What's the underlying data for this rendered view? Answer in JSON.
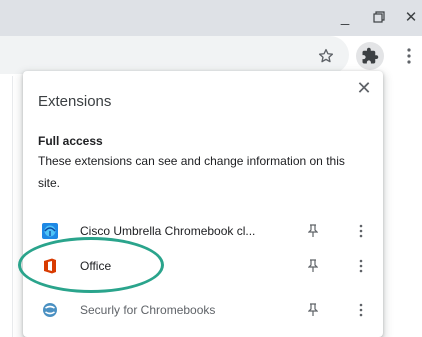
{
  "window": {
    "minimize_label": "_",
    "restore_label": "⧉",
    "close_label": "✕"
  },
  "toolbar": {
    "bookmark_icon": "star-icon",
    "extensions_icon": "puzzle-icon",
    "menu_icon": "kebab-menu-icon"
  },
  "extensions_popup": {
    "title": "Extensions",
    "close_label": "✕",
    "section": {
      "title": "Full access",
      "description": "These extensions can see and change information on this site."
    },
    "items": [
      {
        "name": "Cisco Umbrella Chromebook cl...",
        "icon": "cisco-umbrella-icon",
        "muted": false
      },
      {
        "name": "Office",
        "icon": "office-icon",
        "muted": false
      },
      {
        "name": "Securly for Chromebooks",
        "icon": "securly-icon",
        "muted": true
      }
    ]
  },
  "colors": {
    "highlight": "#2aa48c",
    "office_red": "#d83b01",
    "cisco_blue": "#1e88e5"
  }
}
